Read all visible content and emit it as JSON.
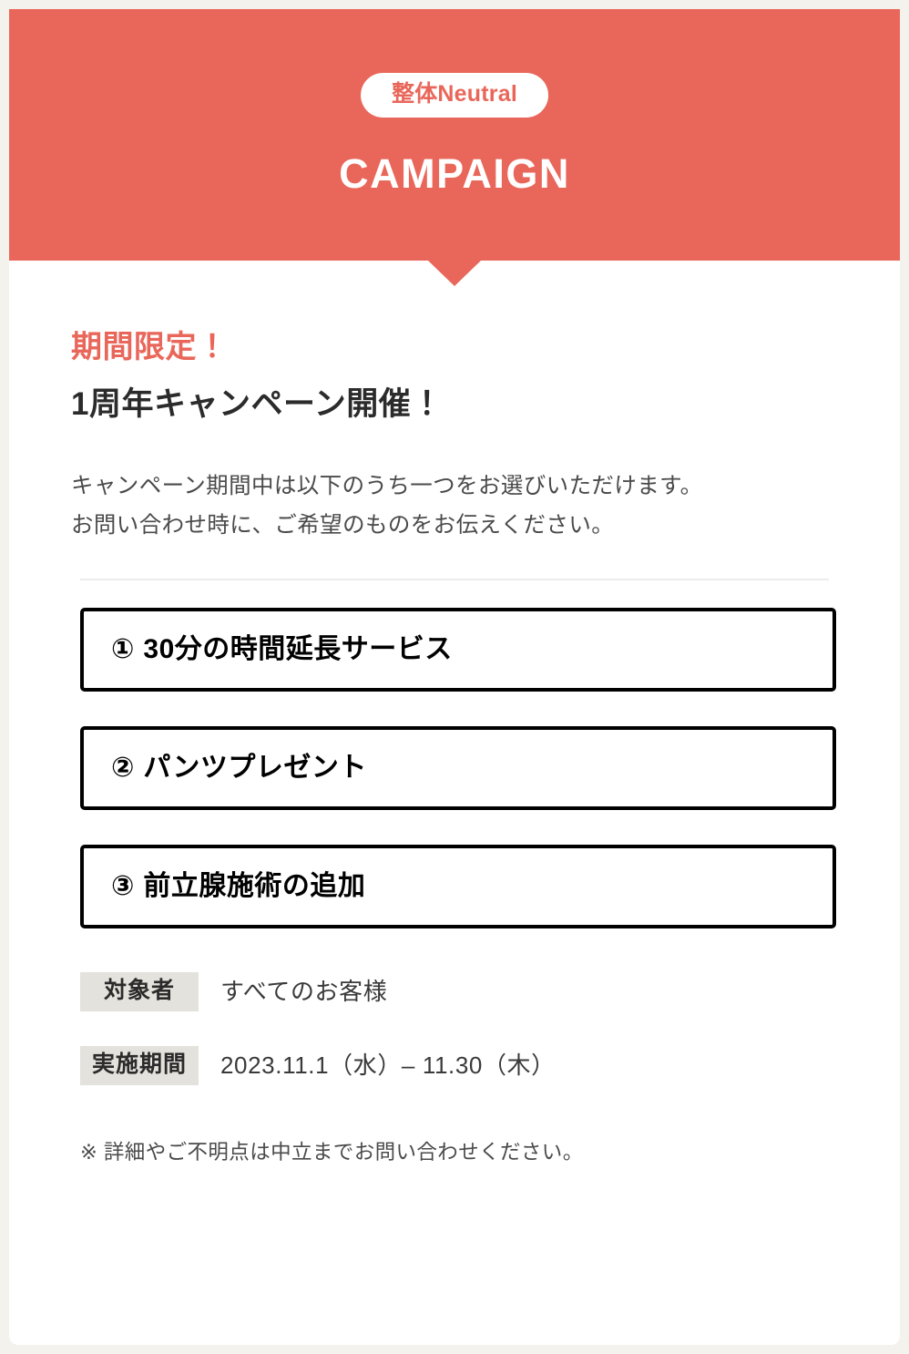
{
  "page": {
    "background_color": "#f4f2ec",
    "card_background": "#ffffff",
    "accent_color": "#e9675a"
  },
  "header": {
    "brand_pill": "整体Neutral",
    "title": "CAMPAIGN",
    "background_color": "#e9675a",
    "pointer_icon": "triangle-down-icon"
  },
  "intro": {
    "eyebrow": "期間限定！",
    "headline": "1周年キャンペーン開催！",
    "lead_line_1": "キャンペーン期間中は以下のうち一つをお選びいただけます。",
    "lead_line_2": "お問い合わせ時に、ご希望のものをお伝えください。"
  },
  "options": [
    {
      "number": "①",
      "label": "30分の時間延長サービス"
    },
    {
      "number": "②",
      "label": "パンツプレゼント"
    },
    {
      "number": "③",
      "label": "前立腺施術の追加"
    }
  ],
  "meta": [
    {
      "label": "対象者",
      "value": "すべてのお客様"
    },
    {
      "label": "実施期間",
      "value": "2023.11.1（水）– 11.30（木）"
    }
  ],
  "footer": {
    "note": "※ 詳細やご不明点は中立までお問い合わせください。"
  }
}
